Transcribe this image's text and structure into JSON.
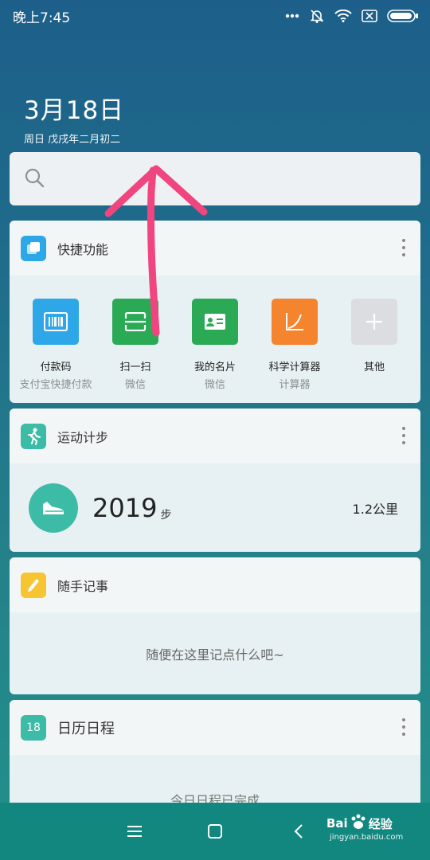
{
  "status_bar": {
    "time": "晚上7:45",
    "icons": [
      "more-dots-icon",
      "mute-icon",
      "wifi-icon",
      "sim-off-icon",
      "battery-icon"
    ]
  },
  "date": {
    "main": "3月18日",
    "sub": "周日 戊戌年二月初二"
  },
  "search": {
    "icon": "search-icon",
    "placeholder": ""
  },
  "quick_functions": {
    "title": "快捷功能",
    "items": [
      {
        "label": "付款码",
        "sub": "支付宝快捷付款",
        "icon": "barcode-icon",
        "color": "#2ea7e8"
      },
      {
        "label": "扫一扫",
        "sub": "微信",
        "icon": "scan-icon",
        "color": "#2aaa55"
      },
      {
        "label": "我的名片",
        "sub": "微信",
        "icon": "business-card-icon",
        "color": "#2aaa55"
      },
      {
        "label": "科学计算器",
        "sub": "计算器",
        "icon": "calculator-icon",
        "color": "#f5842f"
      },
      {
        "label": "其他",
        "sub": "",
        "icon": "plus-icon",
        "color": "#dcdde0"
      }
    ]
  },
  "step_counter": {
    "title": "运动计步",
    "steps": "2019",
    "unit": "步",
    "distance": "1.2公里",
    "color": "#3cbba7"
  },
  "notes": {
    "title": "随手记事",
    "placeholder": "随便在这里记点什么吧~",
    "color": "#f7c531"
  },
  "calendar": {
    "title": "日历日程",
    "icon_text": "18",
    "message": "今日日程已完成",
    "color": "#3cbba7"
  },
  "watermark": {
    "brand": "Bai",
    "brand_suffix": "经验",
    "url": "jingyan.baidu.com"
  },
  "annotation_color": "#f0457f"
}
